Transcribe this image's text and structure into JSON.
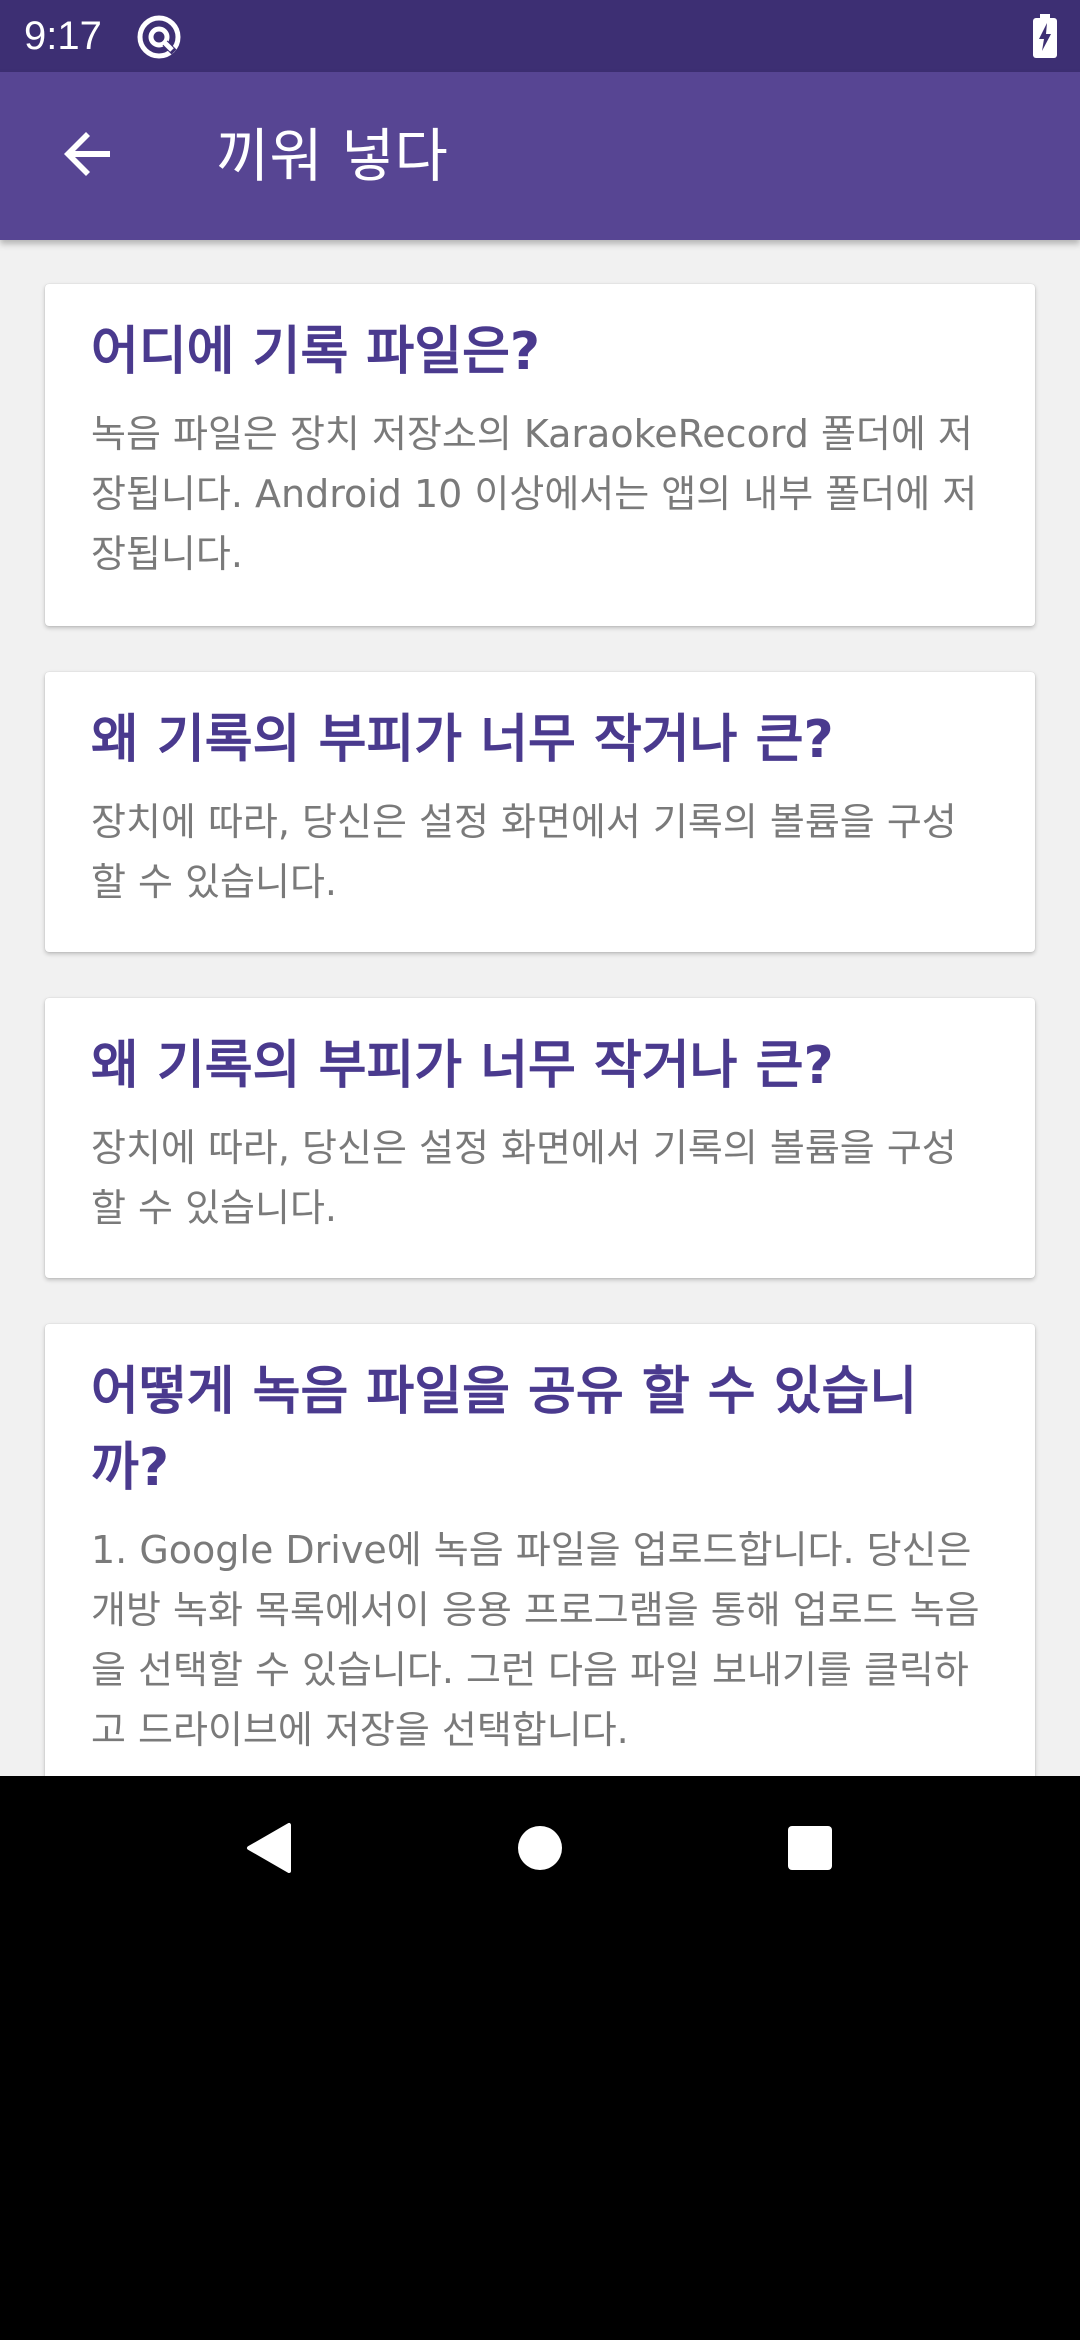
{
  "status_bar": {
    "time": "9:17",
    "app_icon": "at-sign-icon",
    "battery_icon": "battery-charging-icon"
  },
  "app_bar": {
    "back_icon": "arrow-back-icon",
    "title": "끼워 넣다"
  },
  "faq": [
    {
      "title": "어디에 기록 파일은?",
      "body": "녹음 파일은 장치 저장소의 KaraokeRecord 폴더에 저장됩니다. Android 10 이상에서는 앱의 내부 폴더에 저장됩니다."
    },
    {
      "title": "왜 기록의 부피가 너무 작거나 큰?",
      "body": "장치에 따라, 당신은 설정 화면에서 기록의 볼륨을 구성 할 수 있습니다."
    },
    {
      "title": "왜 기록의 부피가 너무 작거나 큰?",
      "body": "장치에 따라, 당신은 설정 화면에서 기록의 볼륨을 구성 할 수 있습니다."
    },
    {
      "title": "어떻게 녹음 파일을 공유 할 수 있습니까?",
      "body": "1. Google Drive에 녹음 파일을 업로드합니다. 당신은 개방 녹화 목록에서이 응용 프로그램을 통해 업로드 녹음을 선택할 수 있습니다. 그런 다음 파일 보내기를 클릭하고 드라이브에 저장을 선택합니다."
    }
  ],
  "nav_bar": {
    "back_icon": "nav-back-triangle-icon",
    "home_icon": "nav-home-circle-icon",
    "recents_icon": "nav-recents-square-icon"
  },
  "colors": {
    "status_bar": "#3d2f73",
    "app_bar": "#574593",
    "card_title": "#4a3a8e",
    "card_body": "#7a7a7a",
    "background": "#f1f1f1"
  }
}
